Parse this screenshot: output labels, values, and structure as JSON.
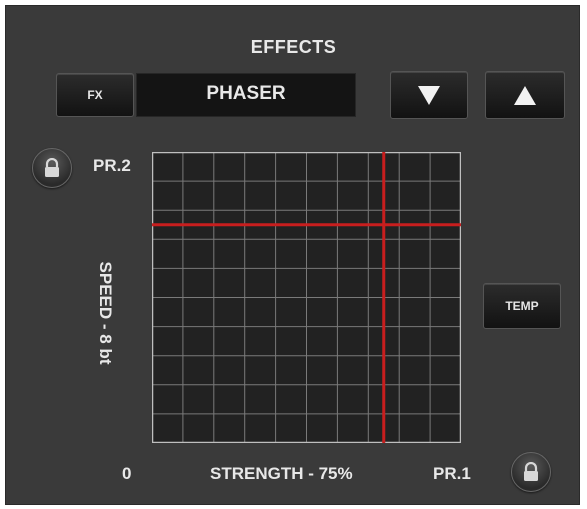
{
  "header": {
    "title": "EFFECTS"
  },
  "toolbar": {
    "fx_label": "FX",
    "effect_name": "PHASER",
    "down_icon": "triangle-down-icon",
    "up_icon": "triangle-up-icon"
  },
  "xy_pad": {
    "y_preset_label": "PR.2",
    "y_axis_label": "SPEED - 8 bt",
    "x_min_label": "0",
    "x_axis_label": "STRENGTH - 75%",
    "x_preset_label": "PR.1",
    "cursor_x_fraction": 0.75,
    "cursor_y_fraction": 0.75,
    "grid_divisions": 10,
    "lock_icon": "lock-icon"
  },
  "side": {
    "temp_label": "TEMP"
  },
  "colors": {
    "panel": "#3a3a3a",
    "grid_line": "#7a7a7a",
    "crosshair": "#c81e1e",
    "text": "#e8e8e8"
  }
}
